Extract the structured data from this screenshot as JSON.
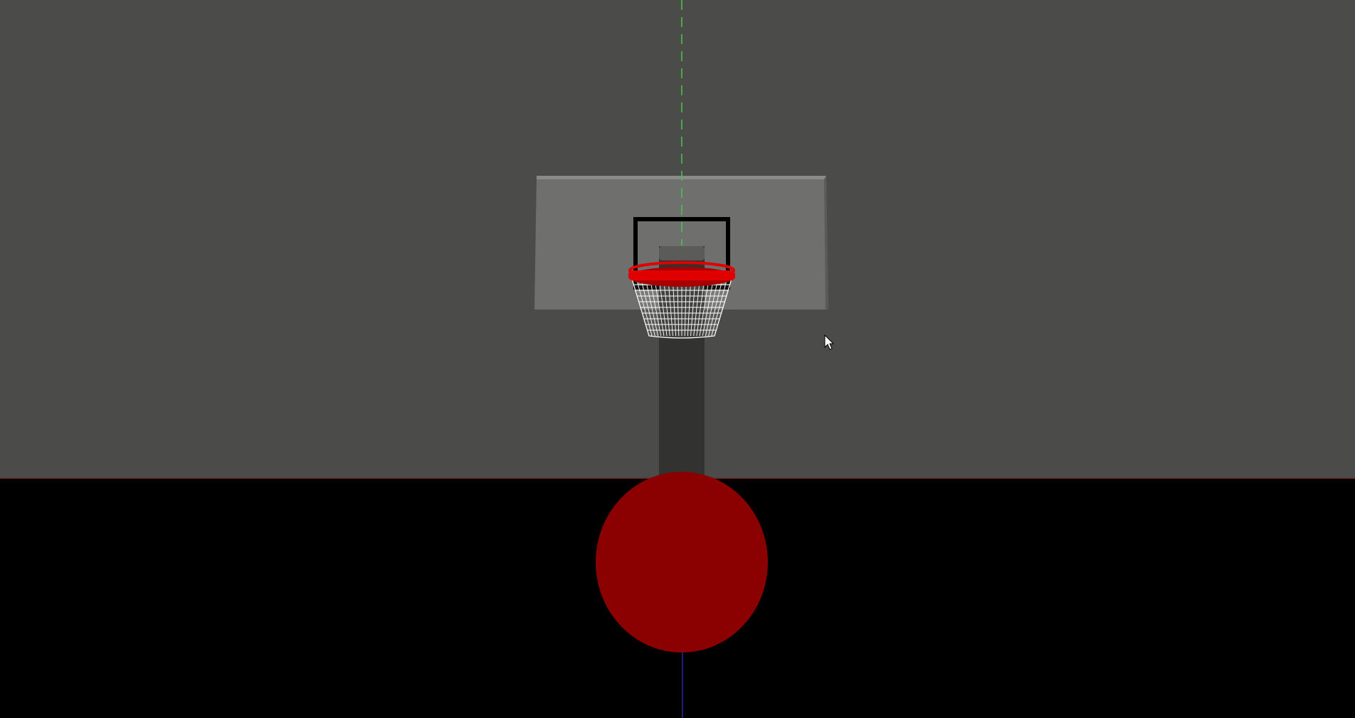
{
  "scene": {
    "colors": {
      "backdrop": "#4b4b4a",
      "floor": "#000000",
      "horizon_line": "#7a2a2a",
      "backboard_face": "#6f6f6e",
      "backboard_edge": "#5a5a59",
      "backboard_top": "#8a8a89",
      "target_square": "#000000",
      "pole": "#323231",
      "pole_top": "#5b5b5a",
      "rim": "#e00000",
      "rim_shade": "#a80000",
      "net": "#ffffff",
      "ball": "#8b0000",
      "aim_guide": "#46c84a",
      "depth_axis": "#1c1c78",
      "cursor": "#ffffff"
    },
    "objects": [
      "backdrop",
      "floor",
      "backboard",
      "shooter-square",
      "hoop-pole",
      "rim",
      "net",
      "basketball",
      "aim-guide-line",
      "depth-axis-line",
      "mouse-cursor"
    ]
  }
}
